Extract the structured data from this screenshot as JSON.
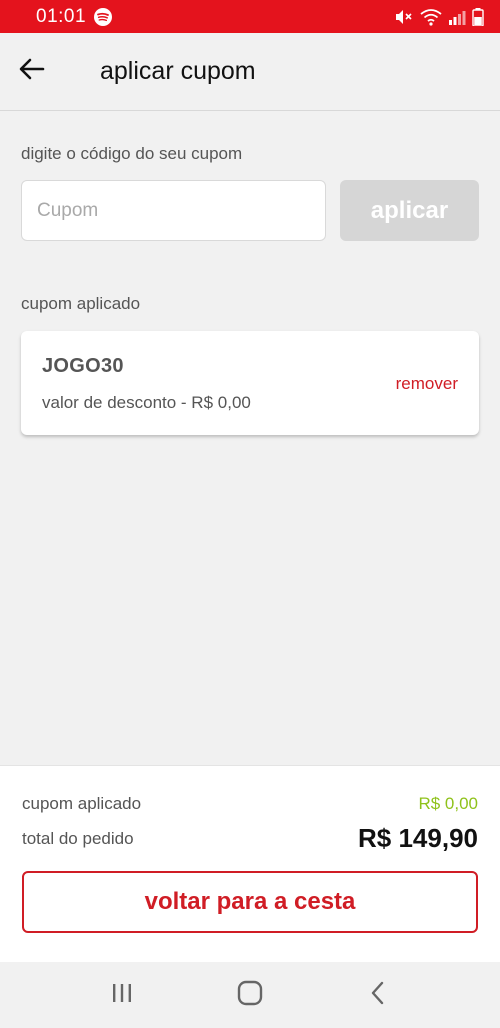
{
  "status_bar": {
    "time": "01:01"
  },
  "header": {
    "title": "aplicar cupom"
  },
  "coupon_form": {
    "label": "digite o código do seu cupom",
    "input_value": "",
    "placeholder": "Cupom",
    "apply_label": "aplicar"
  },
  "applied": {
    "section_label": "cupom aplicado",
    "code": "JOGO30",
    "discount_text": "valor de desconto - R$ 0,00",
    "remove_label": "remover"
  },
  "summary": {
    "coupon_label": "cupom aplicado",
    "coupon_value": "R$ 0,00",
    "total_label": "total do pedido",
    "total_value": "R$ 149,90",
    "back_label": "voltar para a cesta"
  },
  "colors": {
    "brand_red": "#e4131d",
    "accent_red": "#d01d25",
    "discount_green": "#8fc21b",
    "disabled_gray": "#d6d6d6"
  },
  "icons": {
    "status": [
      "spotify-icon",
      "mute-icon",
      "wifi-icon",
      "signal-icon",
      "battery-icon"
    ],
    "header": "arrow-left-icon",
    "nav": [
      "recent-apps-icon",
      "home-icon",
      "back-nav-icon"
    ]
  }
}
